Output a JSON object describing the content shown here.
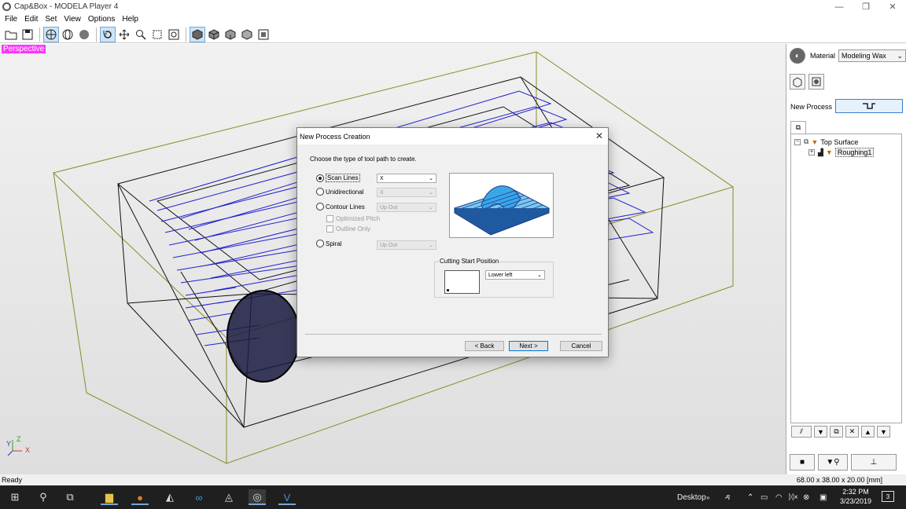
{
  "window": {
    "title": "Cap&Box - MODELA Player 4",
    "minimize": "—",
    "maximize": "❐",
    "close": "✕"
  },
  "menu": [
    "File",
    "Edit",
    "Set",
    "View",
    "Options",
    "Help"
  ],
  "viewport": {
    "label": "Perspective",
    "axes": {
      "y": "Y",
      "z": "Z",
      "x": "X"
    }
  },
  "panel": {
    "material_label": "Material",
    "material_value": "Modeling Wax",
    "new_process_label": "New Process",
    "tree": {
      "root": "Top Surface",
      "child": "Roughing1"
    }
  },
  "status": {
    "left": "Ready",
    "right": "68.00 x 38.00 x 20.00 [mm]"
  },
  "taskbar": {
    "desktop": "Desktop",
    "time": "2:32 PM",
    "date": "3/23/2019",
    "notifications": "3"
  },
  "dialog": {
    "title": "New Process Creation",
    "prompt": "Choose the type of tool path to create.",
    "options": {
      "scan_lines": "Scan Lines",
      "unidirectional": "Unidirectional",
      "contour_lines": "Contour Lines",
      "optimized_pitch": "Optimized Pitch",
      "outline_only": "Outline Only",
      "spiral": "Spiral"
    },
    "combos": {
      "scan": "X",
      "uni": "X",
      "contour": "Up Out",
      "spiral": "Up Out"
    },
    "cutting_start_label": "Cutting Start Position",
    "cutting_start_value": "Lower left",
    "buttons": {
      "back": "< Back",
      "next": "Next >",
      "cancel": "Cancel"
    }
  }
}
